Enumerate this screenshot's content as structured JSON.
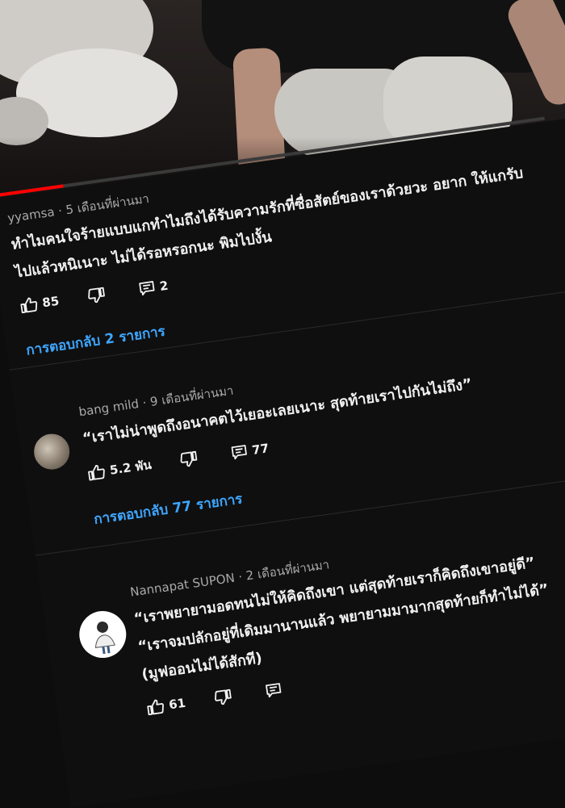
{
  "video": {
    "progress": 0.14,
    "progress_color": "#ff0000"
  },
  "comments": [
    {
      "author": "yyamsa",
      "time": "5 เดือนที่ผ่านมา",
      "lines": [
        "ทำไมคนใจร้ายแบบแกทำไมถึงได้รับความรักที่ซื่อสัตย์ของเราด้วยวะ อยาก ให้แกรับ",
        "ไปแล้วหนิเนาะ ไม่ได้รอหรอกนะ พิมไปงั้น"
      ],
      "likes": "85",
      "reply_count": "2",
      "replies_link": "การตอบกลับ 2 รายการ"
    },
    {
      "author": "bang mild",
      "time": "9 เดือนที่ผ่านมา",
      "lines": [
        "“เราไม่น่าพูดถึงอนาคตไว้เยอะเลยเนาะ สุดท้ายเราไปกันไม่ถึง”"
      ],
      "likes": "5.2 พัน",
      "reply_count": "77",
      "replies_link": "การตอบกลับ 77 รายการ"
    },
    {
      "author": "Nannapat SUPON",
      "time": "2 เดือนที่ผ่านมา",
      "lines": [
        "“เราพยายามอดทนไม่ให้คิดถึงเขา แต่สุดท้ายเราก็คิดถึงเขาอยู่ดี”",
        "“เราจมปลักอยู่ที่เดิมมานานแล้ว พยายามมามากสุดท้ายก็ทำไม่ได้”",
        "(มูฟออนไม่ได้สักที)"
      ],
      "likes": "61"
    }
  ],
  "colors": {
    "link": "#3ea6ff",
    "text": "#f1f1f1",
    "meta": "#aaaaaa",
    "background": "#0f0f0f"
  },
  "icons": [
    "like-icon",
    "dislike-icon",
    "reply-icon"
  ]
}
